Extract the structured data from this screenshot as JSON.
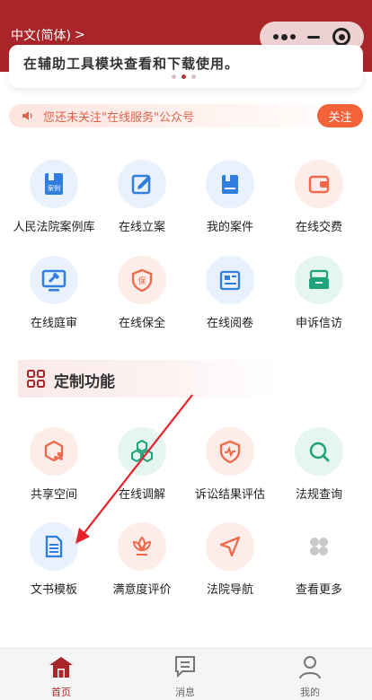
{
  "header": {
    "language_label": "中文(简体)",
    "chevron_glyph": ">",
    "bg_color": "#a8262a"
  },
  "banner": {
    "text": "在辅助工具模块查看和下载使用。",
    "pager_count": 3,
    "pager_active": 1
  },
  "notice": {
    "text": "您还未关注\"在线服务\"公众号",
    "follow_label": "关注",
    "accent": "#f4623a"
  },
  "grid": [
    {
      "label": "人民法院案例库",
      "icon": "case-book-icon",
      "tone": "blue"
    },
    {
      "label": "在线立案",
      "icon": "edit-doc-icon",
      "tone": "blue"
    },
    {
      "label": "我的案件",
      "icon": "folder-book-icon",
      "tone": "blue"
    },
    {
      "label": "在线交费",
      "icon": "wallet-icon",
      "tone": "red"
    },
    {
      "label": "在线庭审",
      "icon": "gavel-screen-icon",
      "tone": "blue"
    },
    {
      "label": "在线保全",
      "icon": "shield-bao-icon",
      "tone": "red"
    },
    {
      "label": "在线阅卷",
      "icon": "newspaper-icon",
      "tone": "blue"
    },
    {
      "label": "申诉信访",
      "icon": "mailbox-icon",
      "tone": "green"
    }
  ],
  "section": {
    "title": "定制功能",
    "icon": "grid-icon"
  },
  "custom_grid": [
    {
      "label": "共享空间",
      "icon": "hexagon-share-icon",
      "tone": "red"
    },
    {
      "label": "在线调解",
      "icon": "hex-cluster-icon",
      "tone": "green"
    },
    {
      "label": "诉讼结果评估",
      "icon": "shield-pulse-icon",
      "tone": "red"
    },
    {
      "label": "法规查询",
      "icon": "search-icon",
      "tone": "green"
    },
    {
      "label": "文书模板",
      "icon": "document-icon",
      "tone": "blue"
    },
    {
      "label": "满意度评价",
      "icon": "lotus-icon",
      "tone": "red"
    },
    {
      "label": "法院导航",
      "icon": "navigation-icon",
      "tone": "red"
    },
    {
      "label": "查看更多",
      "icon": "more-petals-icon",
      "tone": "none"
    }
  ],
  "tabbar": {
    "items": [
      {
        "label": "首页",
        "icon": "home-icon",
        "active": true
      },
      {
        "label": "消息",
        "icon": "message-icon",
        "active": false
      },
      {
        "label": "我的",
        "icon": "profile-icon",
        "active": false
      }
    ]
  }
}
